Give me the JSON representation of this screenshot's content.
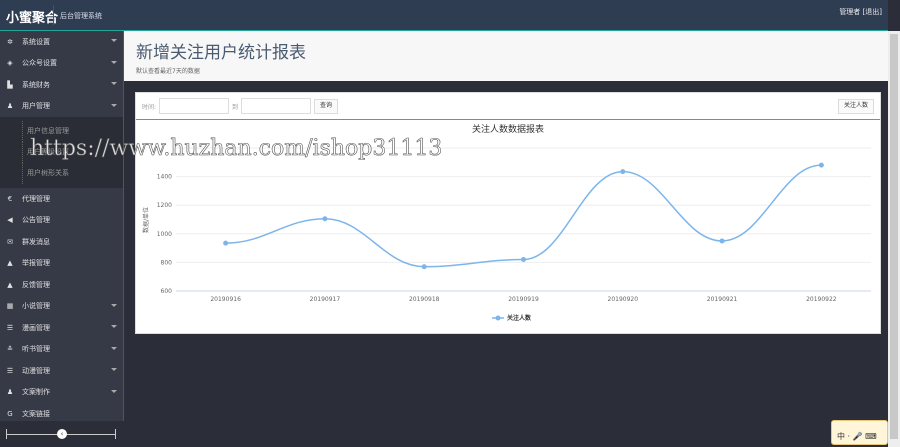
{
  "header": {
    "logo": "小蜜聚合",
    "subtitle": "后台管理系统",
    "user": "管理者 [退出]"
  },
  "sidebar": {
    "items": [
      {
        "label": "系统设置",
        "icon": "gear-icon",
        "glyph": "✲",
        "arrow": true
      },
      {
        "label": "公众号设置",
        "icon": "tags-icon",
        "glyph": "◈",
        "arrow": true
      },
      {
        "label": "系统财务",
        "icon": "bar-chart-icon",
        "glyph": "▙",
        "arrow": true
      },
      {
        "label": "用户管理",
        "icon": "user-icon",
        "glyph": "♟",
        "arrow": true
      }
    ],
    "submenu": [
      "用户信息管理",
      "用户等级设置",
      "用户树形关系"
    ],
    "items2": [
      {
        "label": "代理管理",
        "icon": "euro-icon",
        "glyph": "€",
        "arrow": false
      },
      {
        "label": "公告管理",
        "icon": "bullhorn-icon",
        "glyph": "◀",
        "arrow": false
      },
      {
        "label": "群发消息",
        "icon": "envelope-icon",
        "glyph": "✉",
        "arrow": false
      },
      {
        "label": "举报管理",
        "icon": "warning-icon",
        "glyph": "▲",
        "arrow": false
      },
      {
        "label": "反馈管理",
        "icon": "warning-icon",
        "glyph": "▲",
        "arrow": false
      },
      {
        "label": "小说管理",
        "icon": "grid-icon",
        "glyph": "▦",
        "arrow": true
      },
      {
        "label": "漫画管理",
        "icon": "list-icon",
        "glyph": "☰",
        "arrow": true
      },
      {
        "label": "听书管理",
        "icon": "sliders-icon",
        "glyph": "≛",
        "arrow": true
      },
      {
        "label": "动漫管理",
        "icon": "list-icon",
        "glyph": "☰",
        "arrow": true
      },
      {
        "label": "文案制作",
        "icon": "user-edit-icon",
        "glyph": "♟",
        "arrow": true
      },
      {
        "label": "文案链接",
        "icon": "link-icon",
        "glyph": "G",
        "arrow": false
      }
    ],
    "collapse": "‹"
  },
  "page": {
    "title": "新增关注用户统计报表",
    "desc": "默认查看最近7天的数据"
  },
  "toolbar": {
    "time_label": "时间:",
    "to_label": "到",
    "start": "",
    "end": "",
    "query": "查询",
    "series_btn": "关注人数"
  },
  "watermark": "https://www.huzhan.com/ishop31113",
  "widget": "中 · 🎤 ⌨",
  "chart_data": {
    "type": "line",
    "title": "关注人数数据报表",
    "ylabel": "数据/单位",
    "xlabel": "",
    "categories": [
      "20190916",
      "20190917",
      "20190918",
      "20190919",
      "20190920",
      "20190921",
      "20190922"
    ],
    "series": [
      {
        "name": "关注人数",
        "values": [
          935,
          1105,
          770,
          820,
          1435,
          950,
          1480
        ],
        "color": "#7cb5ec"
      }
    ],
    "ylim": [
      600,
      1600
    ],
    "yticks": [
      600,
      800,
      1000,
      1200,
      1400
    ],
    "legend": "bottom-center",
    "grid": true
  }
}
